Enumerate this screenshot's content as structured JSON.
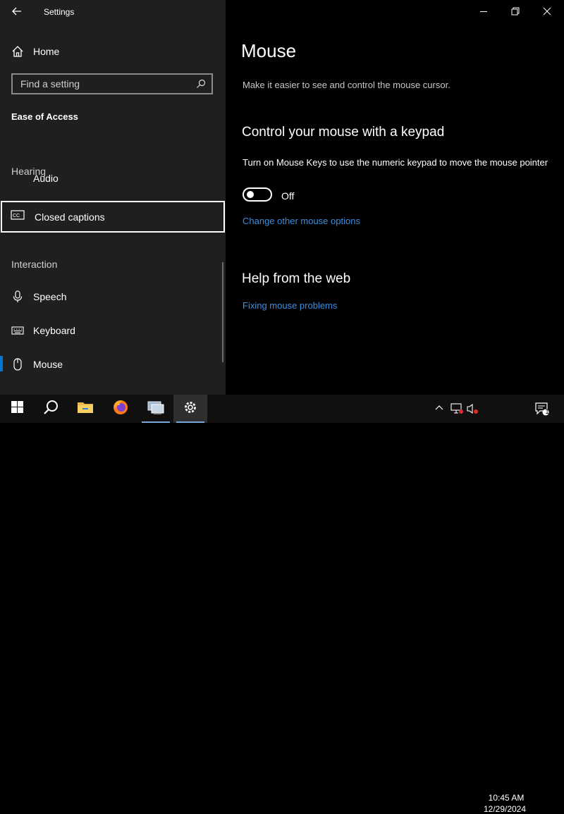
{
  "window": {
    "app_title": "Settings"
  },
  "sidebar": {
    "home_label": "Home",
    "search_placeholder": "Find a setting",
    "category_title": "Ease of Access",
    "section_hearing": "Hearing",
    "partial_item": "Audio",
    "section_interaction": "Interaction",
    "items": [
      {
        "label": "Closed captions",
        "icon": "closed-captions-icon"
      },
      {
        "label": "Speech",
        "icon": "microphone-icon"
      },
      {
        "label": "Keyboard",
        "icon": "keyboard-icon"
      },
      {
        "label": "Mouse",
        "icon": "mouse-icon"
      }
    ]
  },
  "main": {
    "title": "Mouse",
    "description": "Make it easier to see and control the mouse cursor.",
    "section_keypad": "Control your mouse with a keypad",
    "mouse_keys_text": "Turn on Mouse Keys to use the numeric keypad to move the mouse pointer",
    "toggle_state": "Off",
    "link_other_options": "Change other mouse options",
    "section_help": "Help from the web",
    "link_fixing": "Fixing mouse problems"
  },
  "taskbar": {
    "time": "10:45 AM",
    "date": "12/29/2024",
    "notification_count": "1"
  },
  "colors": {
    "accent": "#0078d7",
    "link": "#3b8fe0",
    "sidebar_bg": "#1f1f1f",
    "main_bg": "#000000"
  }
}
